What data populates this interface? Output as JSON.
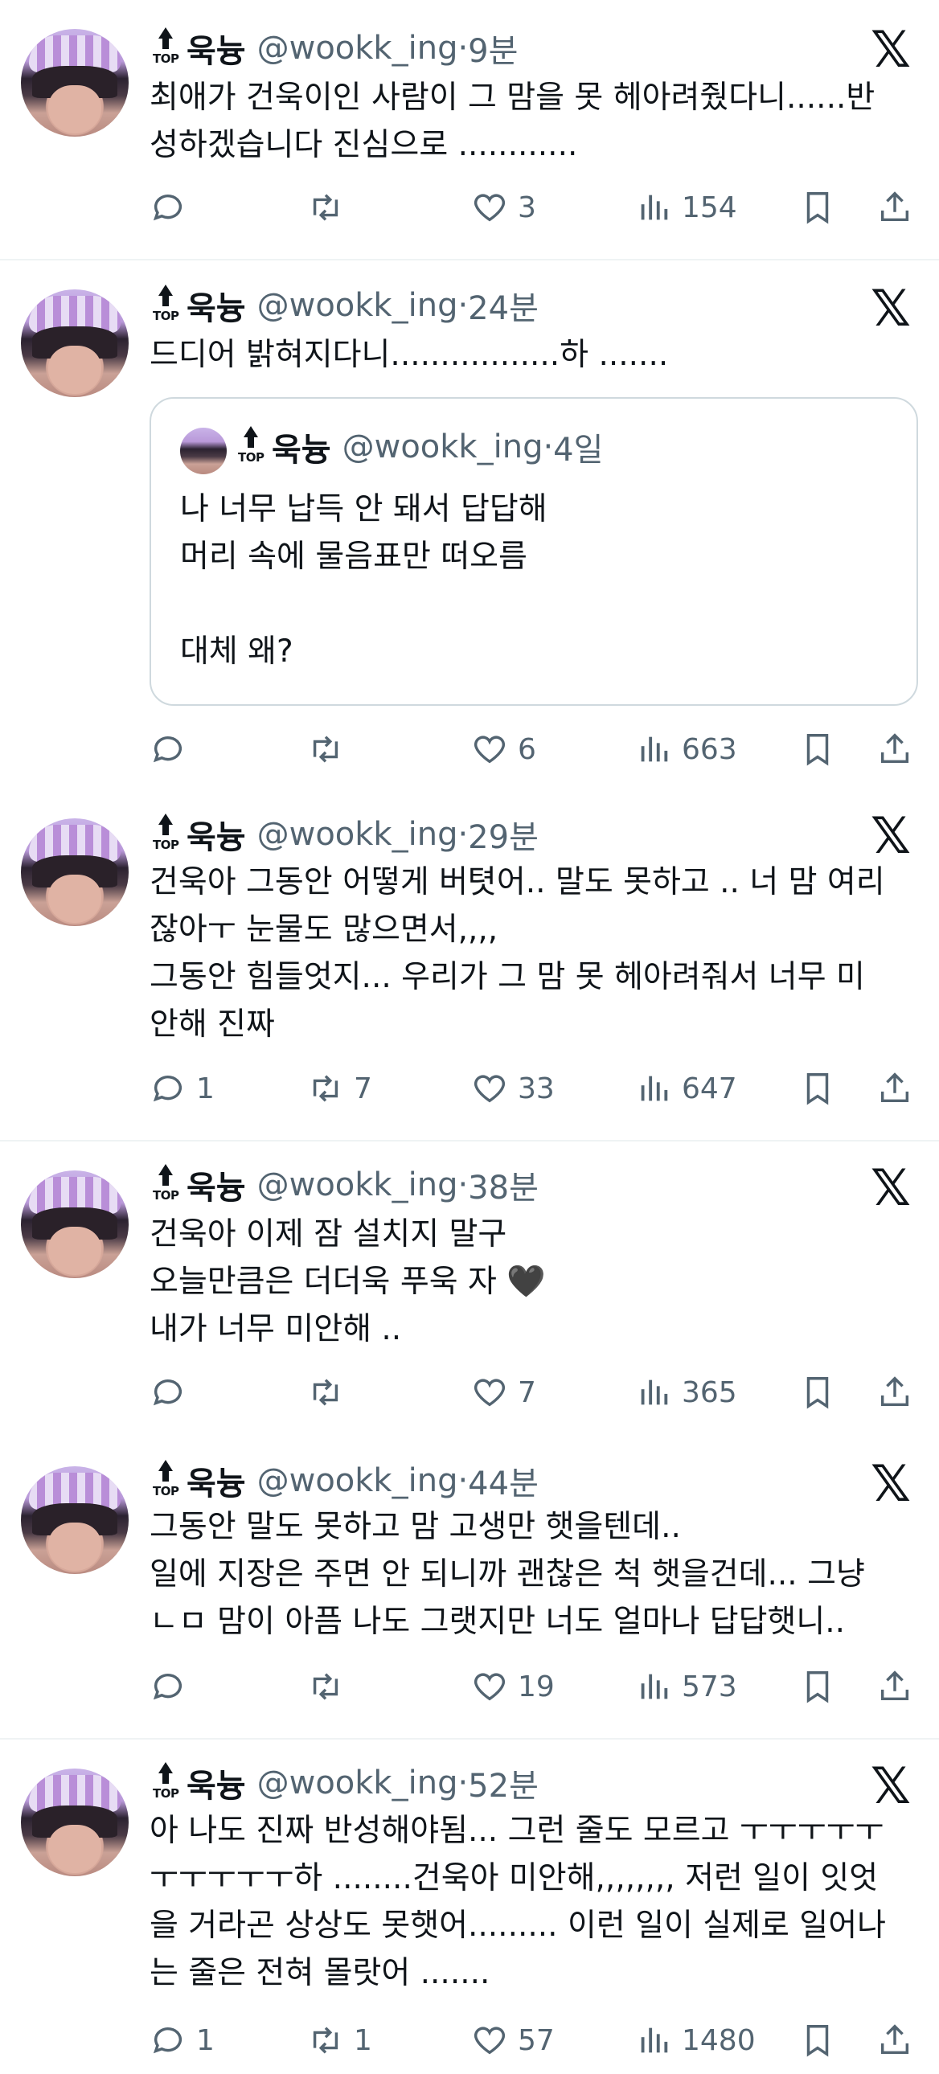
{
  "author": {
    "name": "욱늉",
    "handle": "@wookk_ing",
    "badge": "TOP"
  },
  "tweets": [
    {
      "time": "9분",
      "text": "최애가 건욱이인 사람이 그 맘을 못 헤아려줬다니......반\n성하겠습니다 진심으로 ............",
      "replies": "",
      "retweets": "",
      "likes": "3",
      "views": "154"
    },
    {
      "time": "24분",
      "text": "드디어 밝혀지다니.................하 .......",
      "replies": "",
      "retweets": "",
      "likes": "6",
      "views": "663",
      "quote": {
        "time": "4일",
        "text": "나 너무 납득 안 돼서 답답해\n머리 속에 물음표만 떠오름\n\n대체 왜?"
      }
    },
    {
      "time": "29분",
      "text": "건욱아 그동안 어떻게 버텻어.. 말도 못하고 .. 너 맘 여리\n잖아ㅜ 눈물도 많으면서,,,,\n그동안 힘들엇지... 우리가 그 맘 못 헤아려줘서 너무 미\n안해 진짜",
      "replies": "1",
      "retweets": "7",
      "likes": "33",
      "views": "647"
    },
    {
      "time": "38분",
      "text": "건욱아 이제 잠 설치지 말구\n오늘만큼은 더더욱 푸욱 자 🖤\n내가 너무 미안해 ..",
      "replies": "",
      "retweets": "",
      "likes": "7",
      "views": "365"
    },
    {
      "time": "44분",
      "text": "그동안 말도 못하고 맘 고생만 햇을텐데..\n일에 지장은 주면 안 되니까 괜찮은 척 햇을건데... 그냥\nㄴㅁ 맘이 아픔 나도 그랫지만 너도 얼마나 답답햇니..",
      "replies": "",
      "retweets": "",
      "likes": "19",
      "views": "573"
    },
    {
      "time": "52분",
      "text": "아 나도 진짜 반성해야됨... 그런 줄도 모르고 ㅜㅜㅜㅜㅜ\nㅜㅜㅜㅜㅜ하 ........건욱아 미안해,,,,,,,, 저런 일이 잇엇\n을 거라곤 상상도 못햇어......... 이런 일이 실제로 일어나\n는 줄은 전혀 몰랏어 .......",
      "replies": "1",
      "retweets": "1",
      "likes": "57",
      "views": "1480"
    }
  ],
  "icons": {
    "reply": "reply-icon",
    "retweet": "retweet-icon",
    "like": "heart-icon",
    "views": "views-icon",
    "bookmark": "bookmark-icon",
    "share": "share-icon",
    "platform": "x-logo-icon"
  },
  "colors": {
    "text": "#0f1419",
    "muted": "#536471",
    "border": "#cfd9de",
    "divider": "#eff3f4"
  }
}
